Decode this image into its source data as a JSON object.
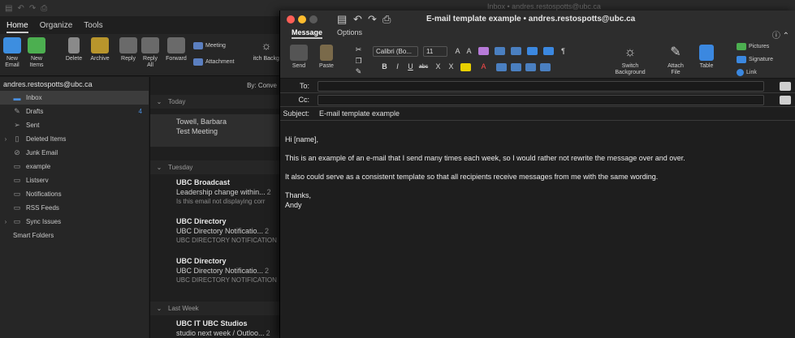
{
  "main": {
    "title": "Inbox • andres.restospotts@ubc.ca",
    "tabs": [
      "Home",
      "Organize",
      "Tools"
    ],
    "ribbon": {
      "new_email": "New Email",
      "new_items": "New Items",
      "delete": "Delete",
      "archive": "Archive",
      "reply": "Reply",
      "reply_all": "Reply All",
      "forward": "Forward",
      "meeting": "Meeting",
      "attachment": "Attachment",
      "switch_background": "Switch Backgrou"
    }
  },
  "folders": {
    "account": "andres.restospotts@ubc.ca",
    "items": [
      {
        "label": "Inbox",
        "count": "",
        "icon": "inbox-icon"
      },
      {
        "label": "Drafts",
        "count": "4",
        "icon": "drafts-icon"
      },
      {
        "label": "Sent",
        "count": "",
        "icon": "sent-icon"
      },
      {
        "label": "Deleted Items",
        "count": "",
        "icon": "trash-icon"
      },
      {
        "label": "Junk Email",
        "count": "",
        "icon": "junk-icon"
      },
      {
        "label": "example",
        "count": "",
        "icon": "folder-icon"
      },
      {
        "label": "Listserv",
        "count": "",
        "icon": "folder-icon"
      },
      {
        "label": "Notifications",
        "count": "",
        "icon": "folder-icon"
      },
      {
        "label": "RSS Feeds",
        "count": "",
        "icon": "folder-icon"
      },
      {
        "label": "Sync Issues",
        "count": "",
        "icon": "folder-icon"
      }
    ],
    "smart_folders": "Smart Folders"
  },
  "message_list": {
    "sort_label": "By: Conve",
    "groups": {
      "today": "Today",
      "tuesday": "Tuesday",
      "last_week": "Last Week"
    },
    "messages": [
      {
        "from": "Towell, Barbara",
        "subject": "Test Meeting",
        "preview": "",
        "date": ""
      },
      {
        "from": "UBC Broadcast",
        "subject": "Leadership change within...",
        "preview": "Is this email not displaying corr",
        "date": "2"
      },
      {
        "from": "UBC Directory",
        "subject": "UBC Directory Notificatio...",
        "preview": "UBC DIRECTORY NOTIFICATION",
        "date": "2"
      },
      {
        "from": "UBC Directory",
        "subject": "UBC Directory Notificatio...",
        "preview": "UBC DIRECTORY NOTIFICATION",
        "date": "2"
      },
      {
        "from": "UBC IT UBC Studios",
        "subject": "studio next week / Outloo...",
        "preview": "",
        "date": "2"
      }
    ]
  },
  "compose": {
    "title": "E-mail template example • andres.restospotts@ubc.ca",
    "tabs": [
      "Message",
      "Options"
    ],
    "ribbon": {
      "send": "Send",
      "paste": "Paste",
      "font": "Calibri (Bo...",
      "size": "11",
      "switch_background": "Switch Background",
      "attach_file": "Attach File",
      "table": "Table",
      "pictures": "Pictures",
      "signature": "Signature",
      "link": "Link"
    },
    "to_label": "To:",
    "cc_label": "Cc:",
    "subject_label": "Subject:",
    "subject_value": "E-mail template example",
    "body": {
      "greeting": "Hi [name],",
      "para1": "This is an example of an e-mail that I send many times each week, so I would rather not rewrite the message over and over.",
      "para2": "It also could serve as a consistent template so that all recipients receive messages from me with the same wording.",
      "closing": "Thanks,",
      "signature": "Andy"
    }
  },
  "colors": {
    "accent": "#4a8fe0",
    "close": "#ff5f57",
    "minimize": "#febc2e",
    "maximize_disabled": "#5a5a5a"
  }
}
